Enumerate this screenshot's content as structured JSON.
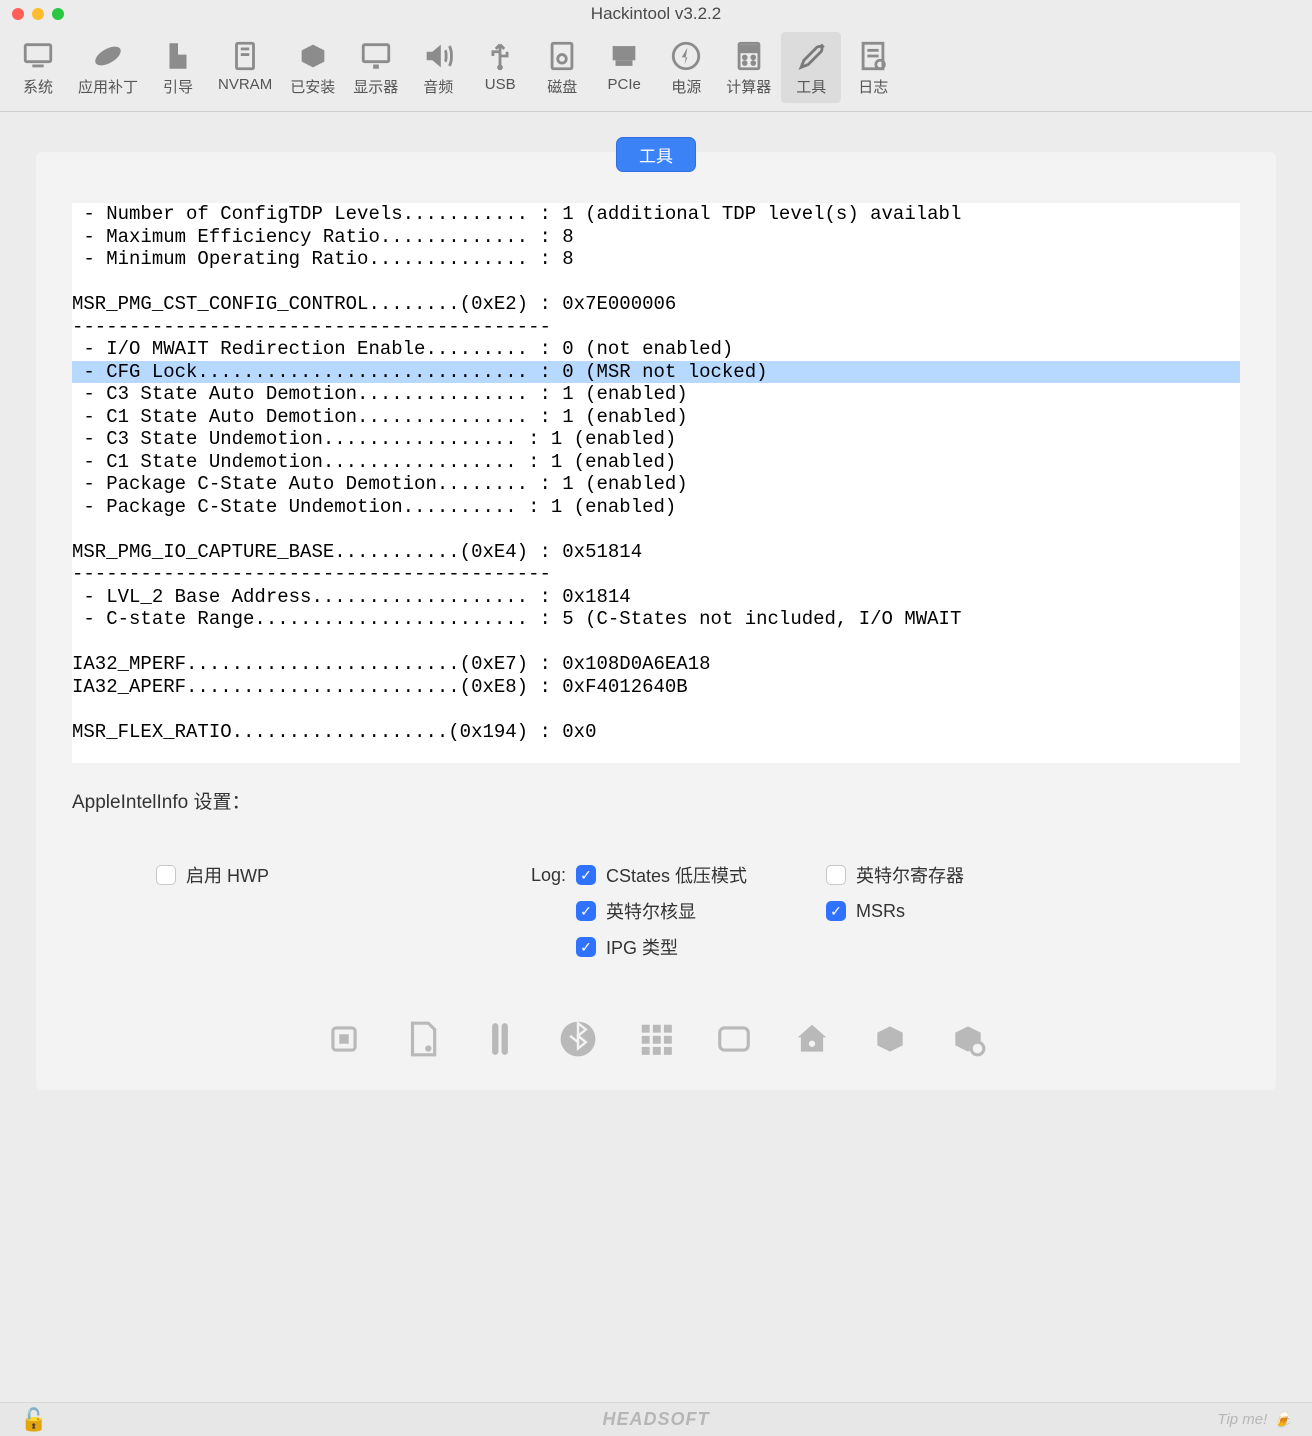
{
  "window": {
    "title": "Hackintool v3.2.2"
  },
  "toolbar": [
    {
      "id": "system",
      "label": "系统"
    },
    {
      "id": "patch",
      "label": "应用补丁"
    },
    {
      "id": "boot",
      "label": "引导"
    },
    {
      "id": "nvram",
      "label": "NVRAM"
    },
    {
      "id": "installed",
      "label": "已安装"
    },
    {
      "id": "display",
      "label": "显示器"
    },
    {
      "id": "audio",
      "label": "音频"
    },
    {
      "id": "usb",
      "label": "USB"
    },
    {
      "id": "disk",
      "label": "磁盘"
    },
    {
      "id": "pcie",
      "label": "PCIe"
    },
    {
      "id": "power",
      "label": "电源"
    },
    {
      "id": "calc",
      "label": "计算器"
    },
    {
      "id": "tools",
      "label": "工具",
      "active": true
    },
    {
      "id": "log",
      "label": "日志"
    }
  ],
  "tab": {
    "label": "工具"
  },
  "console": {
    "lines": [
      " - Number of ConfigTDP Levels........... : 1 (additional TDP level(s) availabl",
      " - Maximum Efficiency Ratio............. : 8",
      " - Minimum Operating Ratio.............. : 8",
      "",
      "MSR_PMG_CST_CONFIG_CONTROL........(0xE2) : 0x7E000006",
      "------------------------------------------",
      " - I/O MWAIT Redirection Enable......... : 0 (not enabled)",
      " - CFG Lock............................. : 0 (MSR not locked)",
      " - C3 State Auto Demotion............... : 1 (enabled)",
      " - C1 State Auto Demotion............... : 1 (enabled)",
      " - C3 State Undemotion................. : 1 (enabled)",
      " - C1 State Undemotion................. : 1 (enabled)",
      " - Package C-State Auto Demotion........ : 1 (enabled)",
      " - Package C-State Undemotion.......... : 1 (enabled)",
      "",
      "MSR_PMG_IO_CAPTURE_BASE...........(0xE4) : 0x51814",
      "------------------------------------------",
      " - LVL_2 Base Address................... : 0x1814",
      " - C-state Range........................ : 5 (C-States not included, I/O MWAIT",
      "",
      "IA32_MPERF........................(0xE7) : 0x108D0A6EA18",
      "IA32_APERF........................(0xE8) : 0xF4012640B",
      "",
      "MSR_FLEX_RATIO...................(0x194) : 0x0"
    ],
    "highlight_index": 7
  },
  "settings": {
    "title": "AppleIntelInfo 设置：",
    "enable_hwp": {
      "label": "启用 HWP",
      "checked": false
    },
    "log_label": "Log:",
    "cstates": {
      "label": "CStates 低压模式",
      "checked": true
    },
    "intel_regs": {
      "label": "英特尔寄存器",
      "checked": false
    },
    "intel_igpu": {
      "label": "英特尔核显",
      "checked": true
    },
    "msrs": {
      "label": "MSRs",
      "checked": true
    },
    "ipg": {
      "label": "IPG 类型",
      "checked": true
    }
  },
  "footer": {
    "brand": "HEADSOFT",
    "tip": "Tip me!"
  }
}
